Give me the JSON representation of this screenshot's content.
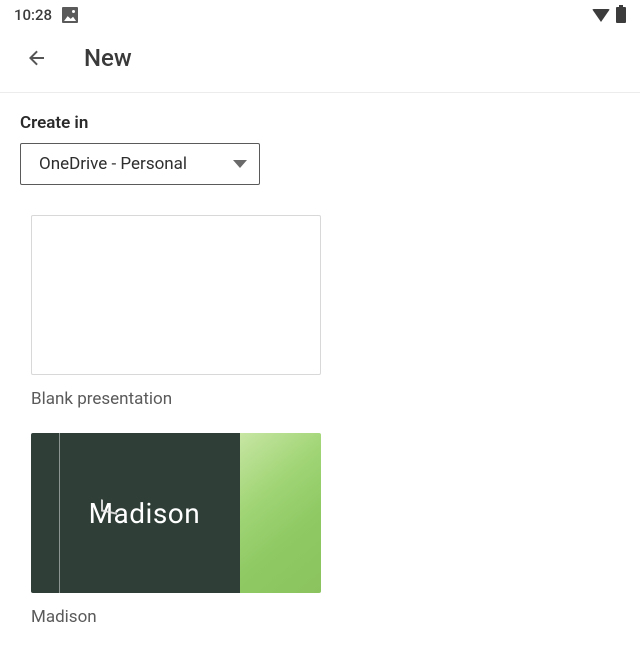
{
  "status_bar": {
    "time": "10:28"
  },
  "app_bar": {
    "title": "New"
  },
  "create_in": {
    "label": "Create in",
    "selected": "OneDrive - Personal"
  },
  "templates": [
    {
      "label": "Blank presentation"
    },
    {
      "label": "Madison",
      "thumb_text": "Madison"
    }
  ]
}
